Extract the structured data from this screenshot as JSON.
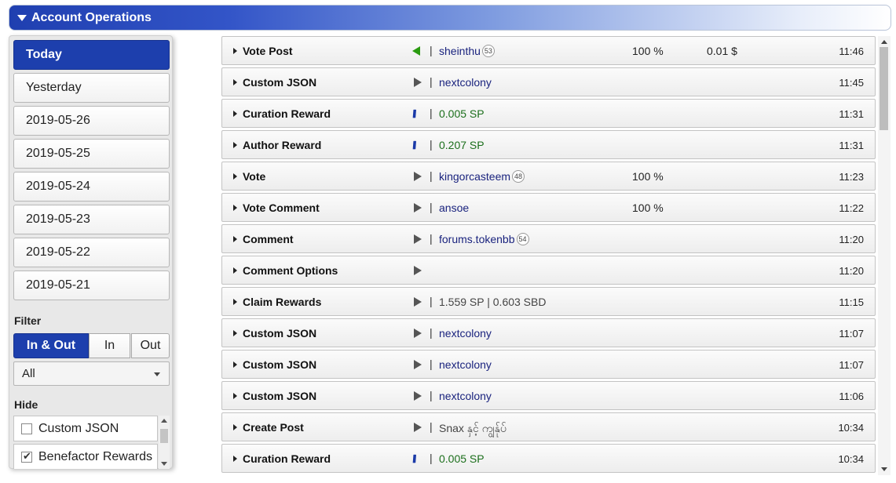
{
  "header": {
    "title": "Account Operations"
  },
  "sidebar": {
    "days": [
      "Today",
      "Yesterday",
      "2019-05-26",
      "2019-05-25",
      "2019-05-24",
      "2019-05-23",
      "2019-05-22",
      "2019-05-21"
    ],
    "filter_label": "Filter",
    "filter_options": [
      "In & Out",
      "In",
      "Out"
    ],
    "select_value": "All",
    "hide_label": "Hide",
    "hide_items": [
      {
        "label": "Custom JSON",
        "checked": false
      },
      {
        "label": "Benefactor Rewards",
        "checked": true
      }
    ]
  },
  "rows": [
    {
      "op": "Vote Post",
      "icon": "left-icon",
      "detail": "sheinthu",
      "badge": "53",
      "pct": "100 %",
      "amt": "0.01 $",
      "time": "11:46"
    },
    {
      "op": "Custom JSON",
      "icon": "play-icon",
      "detail": "nextcolony",
      "badge": "",
      "pct": "",
      "amt": "",
      "time": "11:45"
    },
    {
      "op": "Curation Reward",
      "icon": "steem-icon",
      "detail": "0.005 SP",
      "badge": "",
      "pct": "",
      "amt": "",
      "time": "11:31"
    },
    {
      "op": "Author Reward",
      "icon": "steem-icon",
      "detail": "0.207 SP",
      "badge": "",
      "pct": "",
      "amt": "",
      "time": "11:31"
    },
    {
      "op": "Vote",
      "icon": "play-icon",
      "detail": "kingorcasteem",
      "badge": "48",
      "pct": "100 %",
      "amt": "",
      "time": "11:23"
    },
    {
      "op": "Vote Comment",
      "icon": "play-icon",
      "detail": "ansoe",
      "badge": "",
      "pct": "100 %",
      "amt": "",
      "time": "11:22"
    },
    {
      "op": "Comment",
      "icon": "play-icon",
      "detail": "forums.tokenbb",
      "badge": "54",
      "pct": "",
      "amt": "",
      "time": "11:20"
    },
    {
      "op": "Comment Options",
      "icon": "play-icon",
      "detail": "",
      "badge": "",
      "pct": "",
      "amt": "",
      "time": "11:20"
    },
    {
      "op": "Claim Rewards",
      "icon": "play-icon",
      "detail": "1.559 SP  |  0.603 SBD",
      "badge": "",
      "pct": "",
      "amt": "",
      "time": "11:15"
    },
    {
      "op": "Custom JSON",
      "icon": "play-icon",
      "detail": "nextcolony",
      "badge": "",
      "pct": "",
      "amt": "",
      "time": "11:07"
    },
    {
      "op": "Custom JSON",
      "icon": "play-icon",
      "detail": "nextcolony",
      "badge": "",
      "pct": "",
      "amt": "",
      "time": "11:07"
    },
    {
      "op": "Custom JSON",
      "icon": "play-icon",
      "detail": "nextcolony",
      "badge": "",
      "pct": "",
      "amt": "",
      "time": "11:06"
    },
    {
      "op": "Create Post",
      "icon": "play-icon",
      "detail": "Snax နှင့် ကျွန်ုပ်",
      "badge": "",
      "pct": "",
      "amt": "",
      "time": "10:34"
    },
    {
      "op": "Curation Reward",
      "icon": "steem-icon",
      "detail": "0.005 SP",
      "badge": "",
      "pct": "",
      "amt": "",
      "time": "10:34"
    }
  ],
  "colors": {
    "accent": "#1d3fad",
    "sp_green": "#1c6f1c",
    "vote_green": "#2a9b10",
    "link_blue": "#1a237e"
  }
}
